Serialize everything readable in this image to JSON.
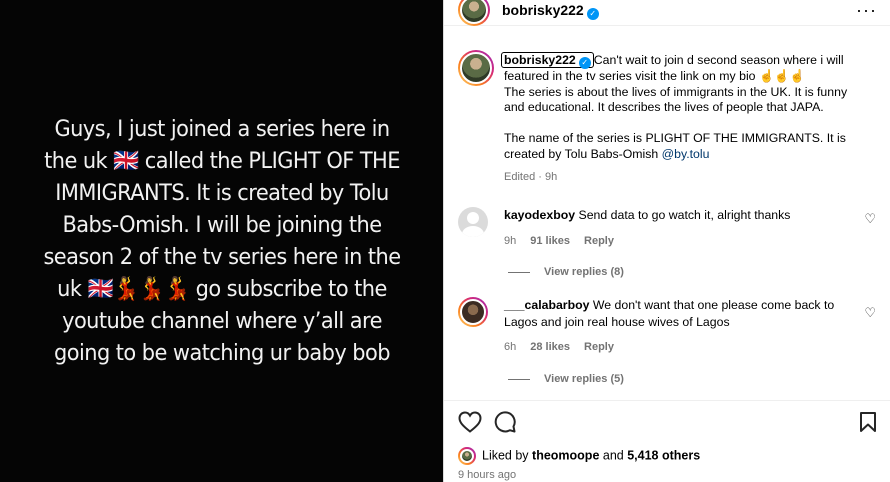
{
  "media": {
    "text": "Guys, I just joined a series here in the uk 🇬🇧 called the PLIGHT OF THE IMMIGRANTS. It is created by Tolu Babs-Omish. I will be joining the season 2 of the tv series here in the uk 🇬🇧💃💃💃 go subscribe to the youtube channel where y’all are going to be  watching ur baby bob"
  },
  "header": {
    "username": "bobrisky222",
    "more": "···"
  },
  "caption": {
    "username": "bobrisky222",
    "body": "Can't wait to join d second season where i will featured in the tv series visit the link on my bio ☝️☝️☝️\nThe series is about the lives of immigrants in the UK. It is funny and educational. It describes the lives of people that JAPA.\n\nThe name of the series is PLIGHT OF THE IMMIGRANTS. It is created by Tolu Babs-Omish ",
    "mention": "@by.tolu",
    "edited": "Edited · 9h"
  },
  "comments": [
    {
      "username": "kayodexboy",
      "text": "Send data to go watch it, alright thanks",
      "time": "9h",
      "likes": "91 likes",
      "reply": "Reply",
      "view_replies": "View replies (8)"
    },
    {
      "username": "___calabarboy",
      "text": "We don't want that one please come back to Lagos and join real house wives of Lagos",
      "time": "6h",
      "likes": "28 likes",
      "reply": "Reply",
      "view_replies": "View replies (5)"
    }
  ],
  "footer": {
    "liked_prefix": "Liked by ",
    "liked_user": "theomoope",
    "liked_mid": " and ",
    "liked_count": "5,418 others",
    "time": "9 hours ago"
  },
  "icons": {
    "like": "heart-icon",
    "comment": "comment-icon",
    "save": "bookmark-icon",
    "verified": "verified-badge-icon"
  },
  "colors": {
    "verified": "#0095f6",
    "mention": "#00376b",
    "secondary_text": "#737373"
  }
}
